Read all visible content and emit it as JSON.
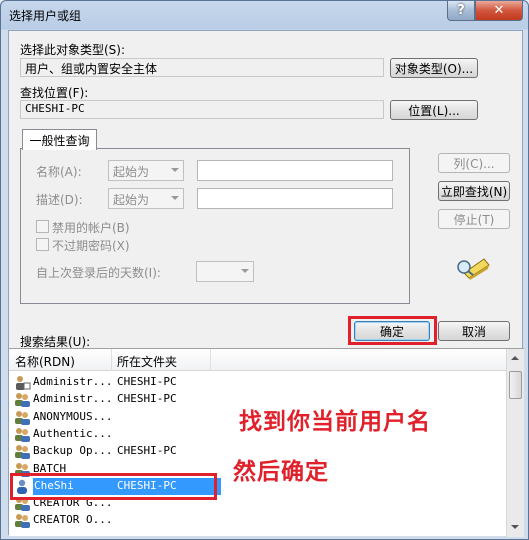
{
  "window": {
    "title": "选择用户或组",
    "help_label": "?",
    "close_label": "✕"
  },
  "object_type": {
    "label": "选择此对象类型(S):",
    "value": "用户、组或内置安全主体",
    "button": "对象类型(O)..."
  },
  "location": {
    "label": "查找位置(F):",
    "value": "CHESHI-PC",
    "button": "位置(L)..."
  },
  "tab": {
    "label": "一般性查询"
  },
  "query": {
    "name_label": "名称(A):",
    "name_mode": "起始为",
    "desc_label": "描述(D):",
    "desc_mode": "起始为",
    "disabled_accounts": "禁用的帐户(B)",
    "no_expire_pwd": "不过期密码(X)",
    "days_label": "自上次登录后的天数(I):"
  },
  "side_buttons": {
    "columns": "列(C)...",
    "find_now": "立即查找(N)",
    "stop": "停止(T)"
  },
  "actions": {
    "ok": "确定",
    "cancel": "取消"
  },
  "results": {
    "label": "搜索结果(U):",
    "columns": [
      "名称(RDN)",
      "所在文件夹"
    ],
    "rows": [
      {
        "name": "Administr...",
        "folder": "CHESHI-PC",
        "icon": "admin-user-icon"
      },
      {
        "name": "Administr...",
        "folder": "CHESHI-PC",
        "icon": "user-group-icon"
      },
      {
        "name": "ANONYMOUS...",
        "folder": "",
        "icon": "user-group-icon"
      },
      {
        "name": "Authentic...",
        "folder": "",
        "icon": "user-group-icon"
      },
      {
        "name": "Backup Op...",
        "folder": "CHESHI-PC",
        "icon": "user-group-icon"
      },
      {
        "name": "BATCH",
        "folder": "",
        "icon": "user-group-icon"
      },
      {
        "name": "CheShi",
        "folder": "CHESHI-PC",
        "icon": "user-icon",
        "selected": true
      },
      {
        "name": "CREATOR G...",
        "folder": "",
        "icon": "user-group-icon"
      },
      {
        "name": "CREATOR O...",
        "folder": "",
        "icon": "user-group-icon"
      }
    ]
  },
  "annotation": {
    "line1": "找到你当前用户名",
    "line2": "然后确定",
    "color": "#e0202a"
  }
}
